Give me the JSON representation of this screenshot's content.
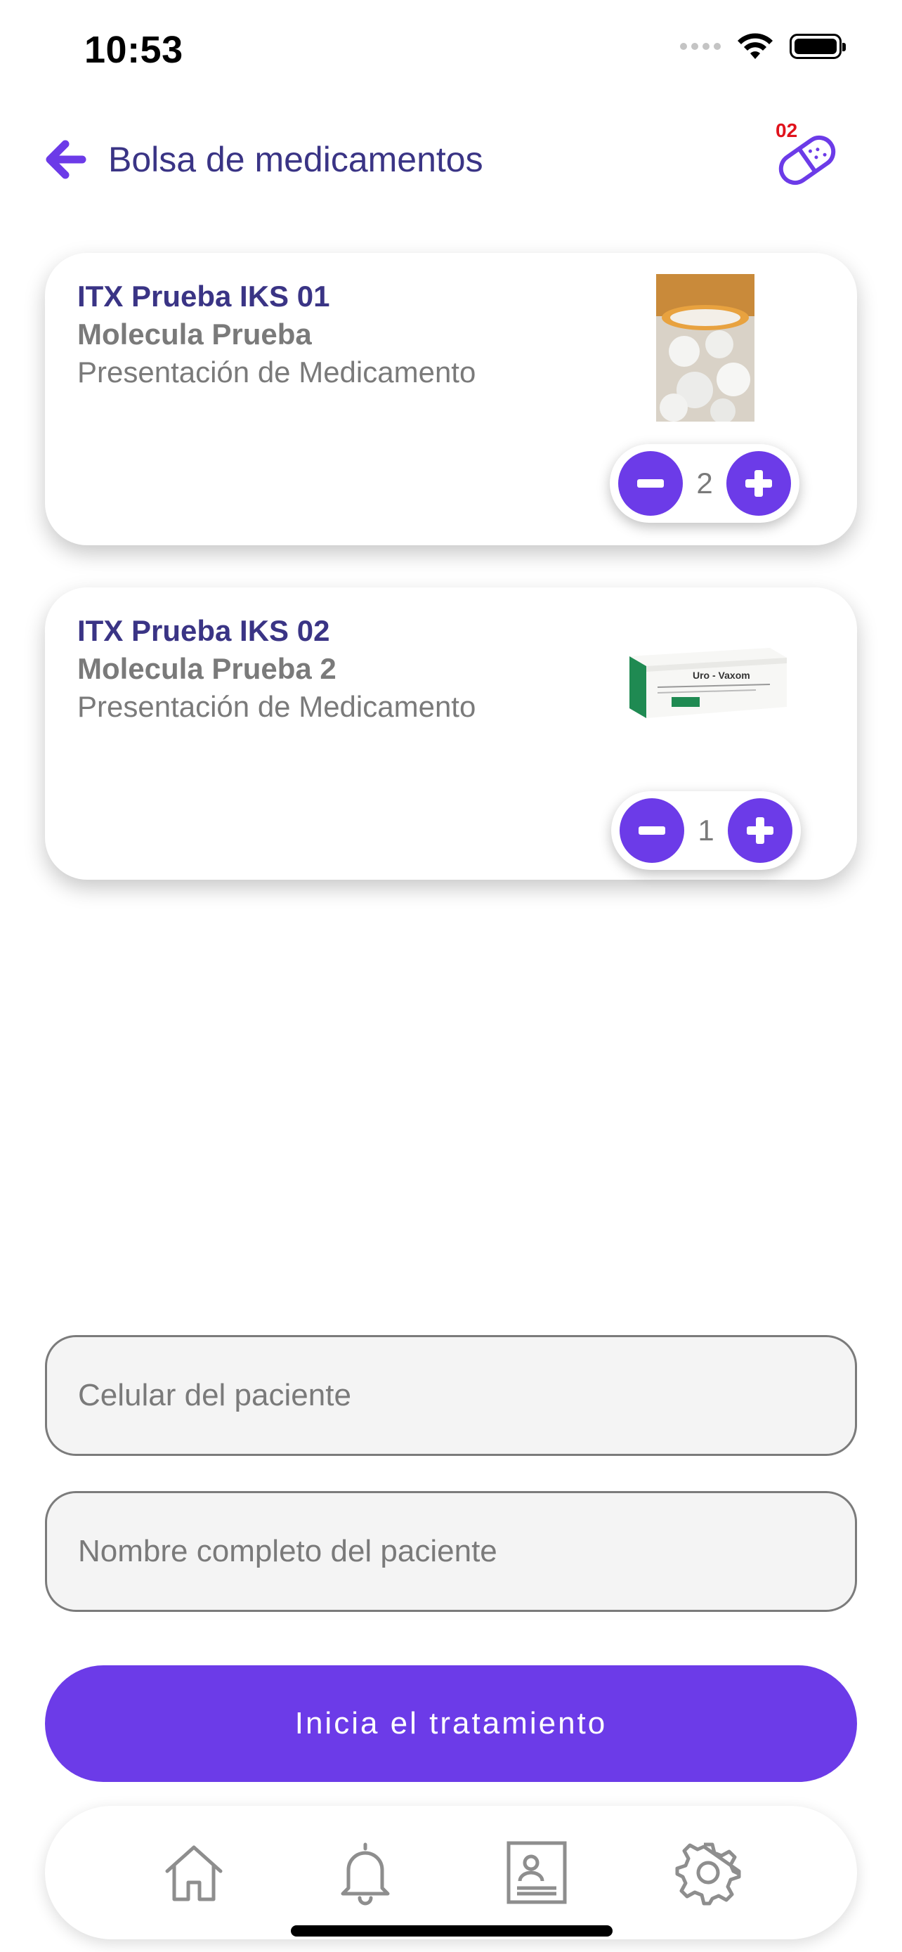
{
  "status_bar": {
    "time": "10:53"
  },
  "header": {
    "title": "Bolsa de medicamentos",
    "bag_count": "02"
  },
  "medications": [
    {
      "name": "ITX Prueba IKS 01",
      "molecule": "Molecula Prueba",
      "presentation": "Presentación de Medicamento",
      "quantity": "2"
    },
    {
      "name": "ITX Prueba IKS 02",
      "molecule": "Molecula Prueba 2",
      "presentation": "Presentación de Medicamento",
      "quantity": "1",
      "box_brand": "Uro - Vaxom"
    }
  ],
  "form": {
    "phone_placeholder": "Celular del paciente",
    "name_placeholder": "Nombre completo del paciente"
  },
  "cta": {
    "label": "Inicia el tratamiento"
  },
  "tabbar": {
    "items": [
      "home-icon",
      "bell-icon",
      "id-card-icon",
      "gear-icon"
    ]
  },
  "colors": {
    "accent": "#6c3be8",
    "title": "#3a3485",
    "text_muted": "#7a7a7a",
    "badge": "#e0131c"
  }
}
